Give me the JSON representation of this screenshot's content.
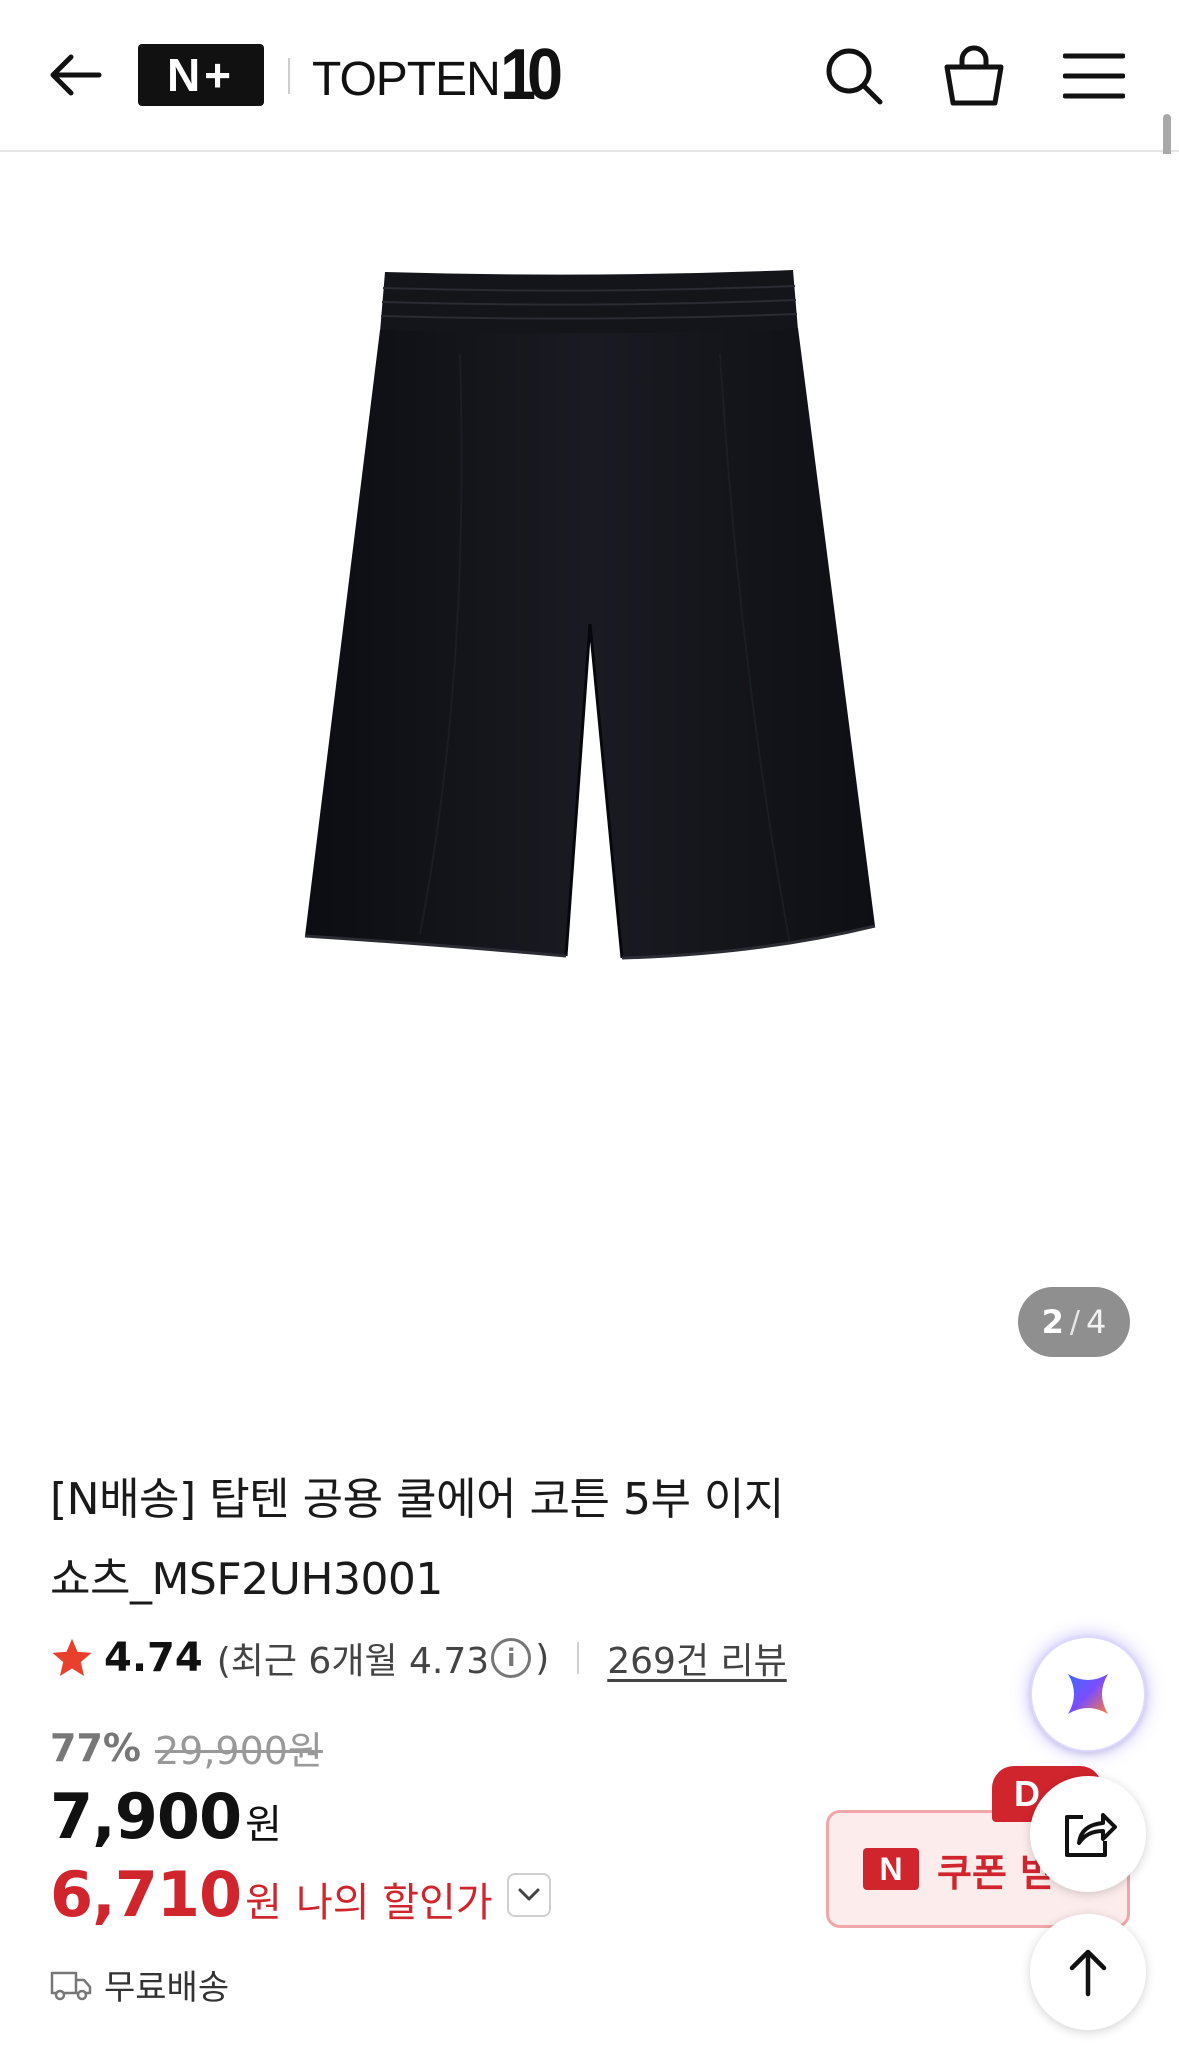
{
  "header": {
    "back_icon": "arrow-left-icon",
    "nplus_logo": "N+",
    "brand_word": "TOPTEN",
    "brand_number": "10",
    "icons": [
      "search-icon",
      "shopping-bag-icon",
      "menu-icon"
    ]
  },
  "gallery": {
    "current": "2",
    "separator": "/",
    "total": "4"
  },
  "product": {
    "title_line1": "[N배송] 탑텐 공용 쿨에어 코튼 5부 이지",
    "title_line2": "쇼츠_MSF2UH3001",
    "rating": "4.74",
    "recent_label": "(최근 6개월 4.73",
    "recent_close": ")",
    "review_link": "269건 리뷰",
    "discount_pct": "77%",
    "original_price": "29,900원",
    "price": "7,900",
    "price_unit": "원",
    "my_price": "6,710",
    "my_price_unit": "원",
    "my_price_label": "나의 할인가",
    "shipping": "무료배송"
  },
  "coupon": {
    "n_mark": "N",
    "label": "쿠폰 받",
    "badge": "D"
  },
  "colors": {
    "accent_red": "#d1252e",
    "star": "#e8402c",
    "counter_bg": "#8f8f8f"
  }
}
